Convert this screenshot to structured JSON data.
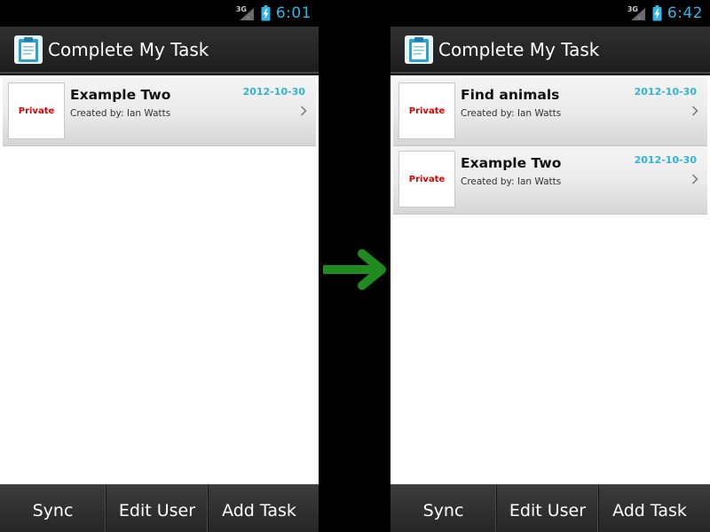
{
  "screens": [
    {
      "status": {
        "network_label": "3G",
        "clock": "6:01"
      },
      "app_title": "Complete My Task",
      "tasks": [
        {
          "title": "Example Two",
          "creator": "Created by: Ian Watts",
          "date": "2012-10-30",
          "privacy": "Private"
        }
      ],
      "buttons": {
        "sync": "Sync",
        "edit_user": "Edit User",
        "add_task": "Add Task"
      }
    },
    {
      "status": {
        "network_label": "3G",
        "clock": "6:42"
      },
      "app_title": "Complete My Task",
      "tasks": [
        {
          "title": "Find animals",
          "creator": "Created by: Ian Watts",
          "date": "2012-10-30",
          "privacy": "Private"
        },
        {
          "title": "Example Two",
          "creator": "Created by: Ian Watts",
          "date": "2012-10-30",
          "privacy": "Private"
        }
      ],
      "buttons": {
        "sync": "Sync",
        "edit_user": "Edit User",
        "add_task": "Add Task"
      }
    }
  ],
  "icons": {
    "app": "clipboard-icon",
    "network": "signal-icon",
    "battery": "battery-charging-icon",
    "chevron": "chevron-right-icon",
    "transition": "arrow-right-icon"
  },
  "colors": {
    "clock": "#33b5e5",
    "date": "#2fb3d7",
    "privacy": "#e00000",
    "arrow": "#1f8a1f"
  }
}
